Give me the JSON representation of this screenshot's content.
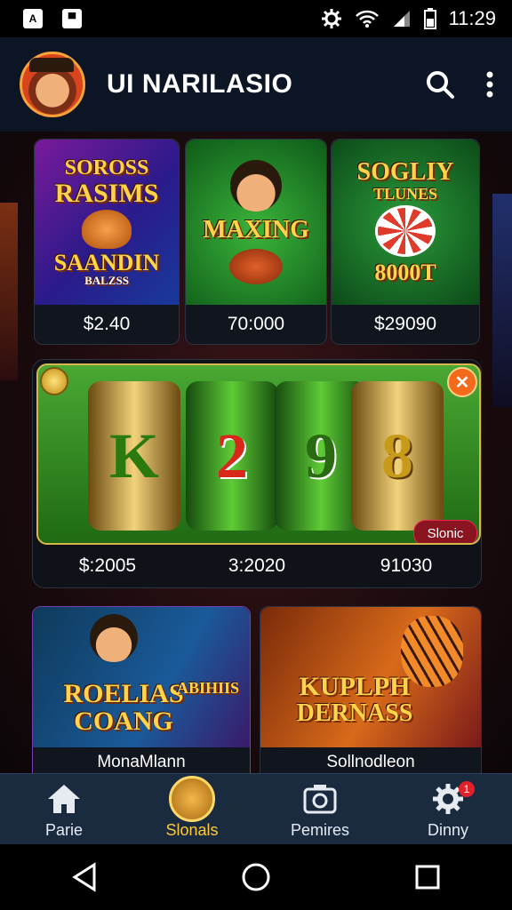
{
  "status_bar": {
    "time": "11:29",
    "icons": [
      "app-icon",
      "cat-icon",
      "settings-gear-icon",
      "wifi-icon",
      "signal-icon",
      "battery-icon"
    ]
  },
  "app_bar": {
    "title": "UI NARILASIO",
    "actions": [
      "search-icon",
      "more-vert-icon"
    ]
  },
  "top_games": [
    {
      "title_lines": [
        "SOROSS",
        "RASIMS",
        "SAANDIN",
        "BALZSS"
      ],
      "price": "$2.40"
    },
    {
      "title_lines": [
        "MAXING"
      ],
      "price": "70:000"
    },
    {
      "title_lines": [
        "SOGLIY",
        "TLUNES",
        "8000T"
      ],
      "price": "$29090"
    }
  ],
  "slot_machine": {
    "symbols": [
      "K",
      "2",
      "9",
      "8"
    ],
    "tag_label": "Slonic",
    "values": [
      "$:2005",
      "3:2020",
      "91030"
    ]
  },
  "bottom_games": [
    {
      "title_lines": [
        "ROELIAS",
        "COANG"
      ],
      "sub": "ABIHIIS",
      "name": "MonaMlann"
    },
    {
      "title_lines": [
        "KUPLPH",
        "DERNASS"
      ],
      "name": "Sollnodleon"
    }
  ],
  "bottom_nav": [
    {
      "label": "Parie",
      "icon": "home-icon"
    },
    {
      "label": "Slonals",
      "icon": "coin-dog-icon"
    },
    {
      "label": "Pemires",
      "icon": "photo-icon"
    },
    {
      "label": "Dinny",
      "icon": "gear-icon",
      "badge": "1"
    }
  ],
  "colors": {
    "accent": "#ffc93a",
    "nav_bg": "#1a2b40",
    "appbar_bg": "#0b1524"
  }
}
